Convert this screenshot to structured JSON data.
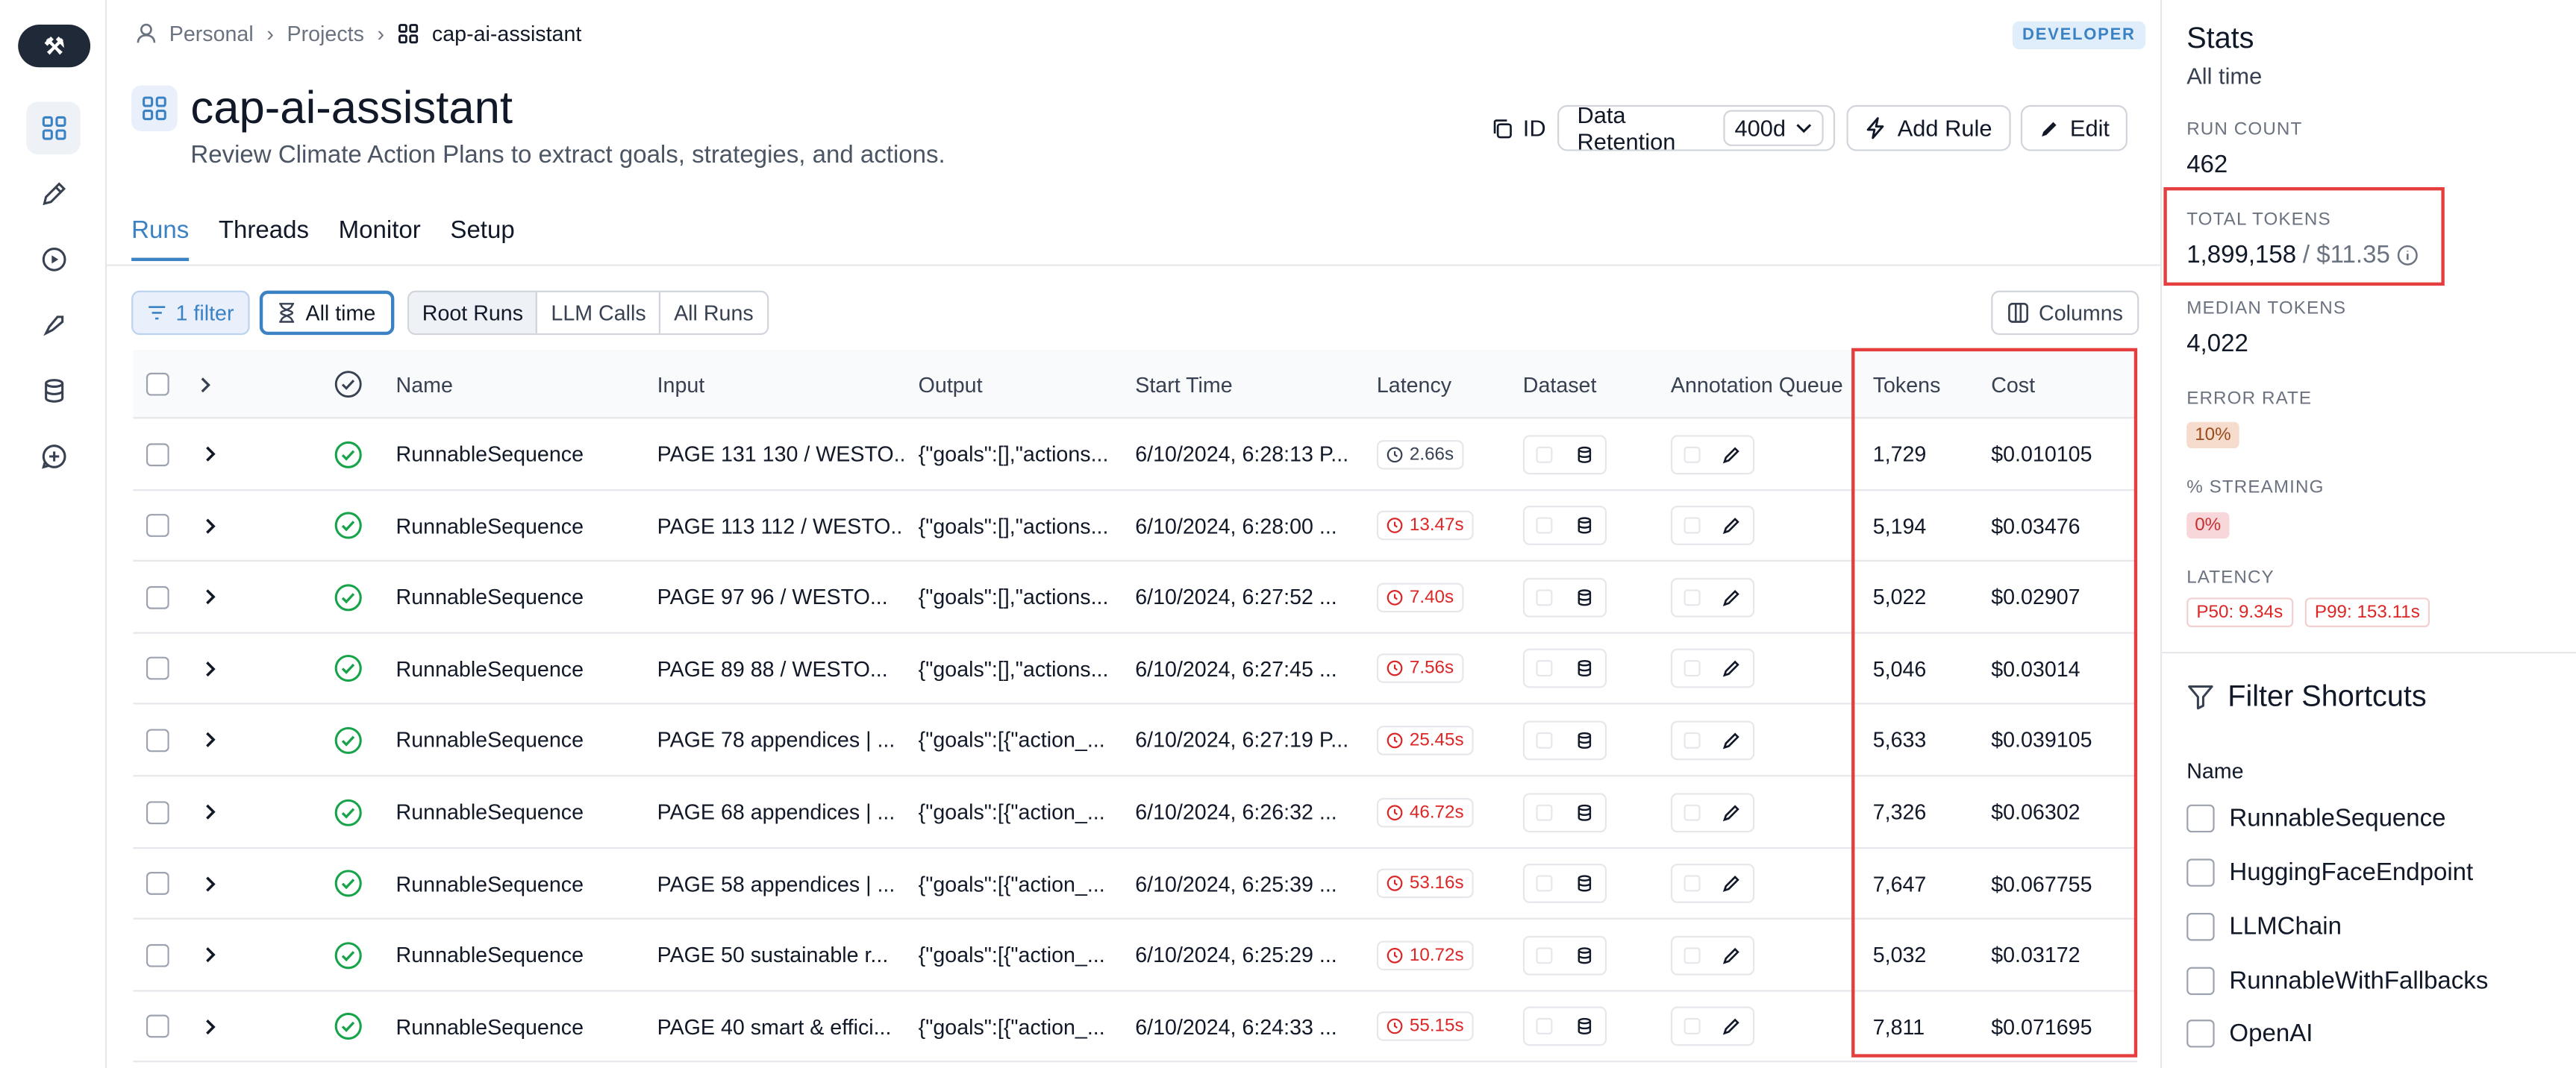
{
  "breadcrumb": {
    "items": [
      "Personal",
      "Projects",
      "cap-ai-assistant"
    ]
  },
  "badge": "DEVELOPER",
  "project": {
    "title": "cap-ai-assistant",
    "description": "Review Climate Action Plans to extract goals, strategies, and actions."
  },
  "actions": {
    "id_label": "ID",
    "retention_label": "Data Retention",
    "retention_value": "400d",
    "add_rule": "Add Rule",
    "edit": "Edit"
  },
  "tabs": [
    "Runs",
    "Threads",
    "Monitor",
    "Setup"
  ],
  "toolbar": {
    "filter": "1 filter",
    "time": "All time",
    "segments": [
      "Root Runs",
      "LLM Calls",
      "All Runs"
    ],
    "columns": "Columns"
  },
  "table": {
    "headers": {
      "name": "Name",
      "input": "Input",
      "output": "Output",
      "start_time": "Start Time",
      "latency": "Latency",
      "dataset": "Dataset",
      "annotation": "Annotation Queue",
      "tokens": "Tokens",
      "cost": "Cost"
    },
    "rows": [
      {
        "name": "RunnableSequence",
        "input": "PAGE 131 130 / WESTO...",
        "output": "{\"goals\":[],\"actions...",
        "start": "6/10/2024, 6:28:13 P...",
        "latency": "2.66s",
        "latency_ok": true,
        "tokens": "1,729",
        "cost": "$0.010105"
      },
      {
        "name": "RunnableSequence",
        "input": "PAGE 113 112 / WESTO...",
        "output": "{\"goals\":[],\"actions...",
        "start": "6/10/2024, 6:28:00 ...",
        "latency": "13.47s",
        "latency_ok": false,
        "tokens": "5,194",
        "cost": "$0.03476"
      },
      {
        "name": "RunnableSequence",
        "input": "PAGE 97 96 / WESTO...",
        "output": "{\"goals\":[],\"actions...",
        "start": "6/10/2024, 6:27:52 ...",
        "latency": "7.40s",
        "latency_ok": false,
        "tokens": "5,022",
        "cost": "$0.02907"
      },
      {
        "name": "RunnableSequence",
        "input": "PAGE 89 88 / WESTO...",
        "output": "{\"goals\":[],\"actions...",
        "start": "6/10/2024, 6:27:45 ...",
        "latency": "7.56s",
        "latency_ok": false,
        "tokens": "5,046",
        "cost": "$0.03014"
      },
      {
        "name": "RunnableSequence",
        "input": "PAGE 78 appendices | ...",
        "output": "{\"goals\":[{\"action_...",
        "start": "6/10/2024, 6:27:19 P...",
        "latency": "25.45s",
        "latency_ok": false,
        "tokens": "5,633",
        "cost": "$0.039105"
      },
      {
        "name": "RunnableSequence",
        "input": "PAGE 68 appendices | ...",
        "output": "{\"goals\":[{\"action_...",
        "start": "6/10/2024, 6:26:32 ...",
        "latency": "46.72s",
        "latency_ok": false,
        "tokens": "7,326",
        "cost": "$0.06302"
      },
      {
        "name": "RunnableSequence",
        "input": "PAGE 58 appendices | ...",
        "output": "{\"goals\":[{\"action_...",
        "start": "6/10/2024, 6:25:39 ...",
        "latency": "53.16s",
        "latency_ok": false,
        "tokens": "7,647",
        "cost": "$0.067755"
      },
      {
        "name": "RunnableSequence",
        "input": "PAGE 50 sustainable r...",
        "output": "{\"goals\":[{\"action_...",
        "start": "6/10/2024, 6:25:29 ...",
        "latency": "10.72s",
        "latency_ok": false,
        "tokens": "5,032",
        "cost": "$0.03172"
      },
      {
        "name": "RunnableSequence",
        "input": "PAGE 40 smart & effici...",
        "output": "{\"goals\":[{\"action_...",
        "start": "6/10/2024, 6:24:33 ...",
        "latency": "55.15s",
        "latency_ok": false,
        "tokens": "7,811",
        "cost": "$0.071695"
      }
    ]
  },
  "stats": {
    "title": "Stats",
    "subtitle": "All time",
    "run_count_label": "RUN COUNT",
    "run_count": "462",
    "total_tokens_label": "TOTAL TOKENS",
    "total_tokens": "1,899,158",
    "total_cost": "/ $11.35",
    "median_tokens_label": "MEDIAN TOKENS",
    "median_tokens": "4,022",
    "error_rate_label": "ERROR RATE",
    "error_rate": "10%",
    "streaming_label": "% STREAMING",
    "streaming": "0%",
    "latency_label": "LATENCY",
    "p50": "P50: 9.34s",
    "p99": "P99: 153.11s"
  },
  "filter_shortcuts": {
    "title": "Filter Shortcuts",
    "name_label": "Name",
    "items": [
      "RunnableSequence",
      "HuggingFaceEndpoint",
      "LLMChain",
      "RunnableWithFallbacks",
      "OpenAI"
    ]
  },
  "colors": {
    "accent": "#3b82c4",
    "error": "#dc2626",
    "success": "#16a34a",
    "highlight": "#e53e3e"
  }
}
